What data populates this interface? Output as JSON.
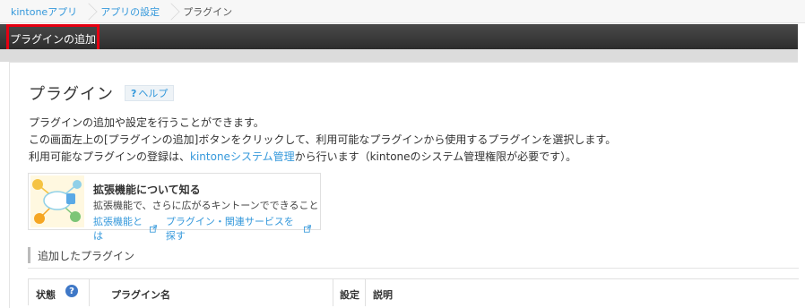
{
  "breadcrumb": {
    "items": [
      {
        "label": "kintoneアプリ"
      },
      {
        "label": "アプリの設定"
      },
      {
        "label": "プラグイン"
      }
    ]
  },
  "toolbar": {
    "add_plugin_label": "プラグインの追加",
    "highlight_color": "#e60012"
  },
  "main": {
    "title": "プラグイン",
    "help": {
      "icon": "question-icon",
      "label": "ヘルプ",
      "q": "?"
    },
    "description": {
      "line1": "プラグインの追加や設定を行うことができます。",
      "line2": "この画面左上の[プラグインの追加]ボタンをクリックして、利用可能なプラグインから使用するプラグインを選択します。",
      "line3_prefix": "利用可能なプラグインの登録は、",
      "line3_link": "kintoneシステム管理",
      "line3_suffix": "から行います（kintoneのシステム管理権限が必要です）。"
    },
    "promo": {
      "title": "拡張機能について知る",
      "subtitle": "拡張機能で、さらに広がるキントーンでできること",
      "link1": "拡張機能とは",
      "link2": "プラグイン・関連サービスを探す"
    },
    "section_title": "追加したプラグイン",
    "table": {
      "columns": {
        "status": "状態",
        "name": "プラグイン名",
        "settings": "設定",
        "description": "説明"
      },
      "status_help_icon": "question-circle-icon"
    }
  },
  "colors": {
    "link": "#3498db",
    "toolbar": "#333333"
  }
}
